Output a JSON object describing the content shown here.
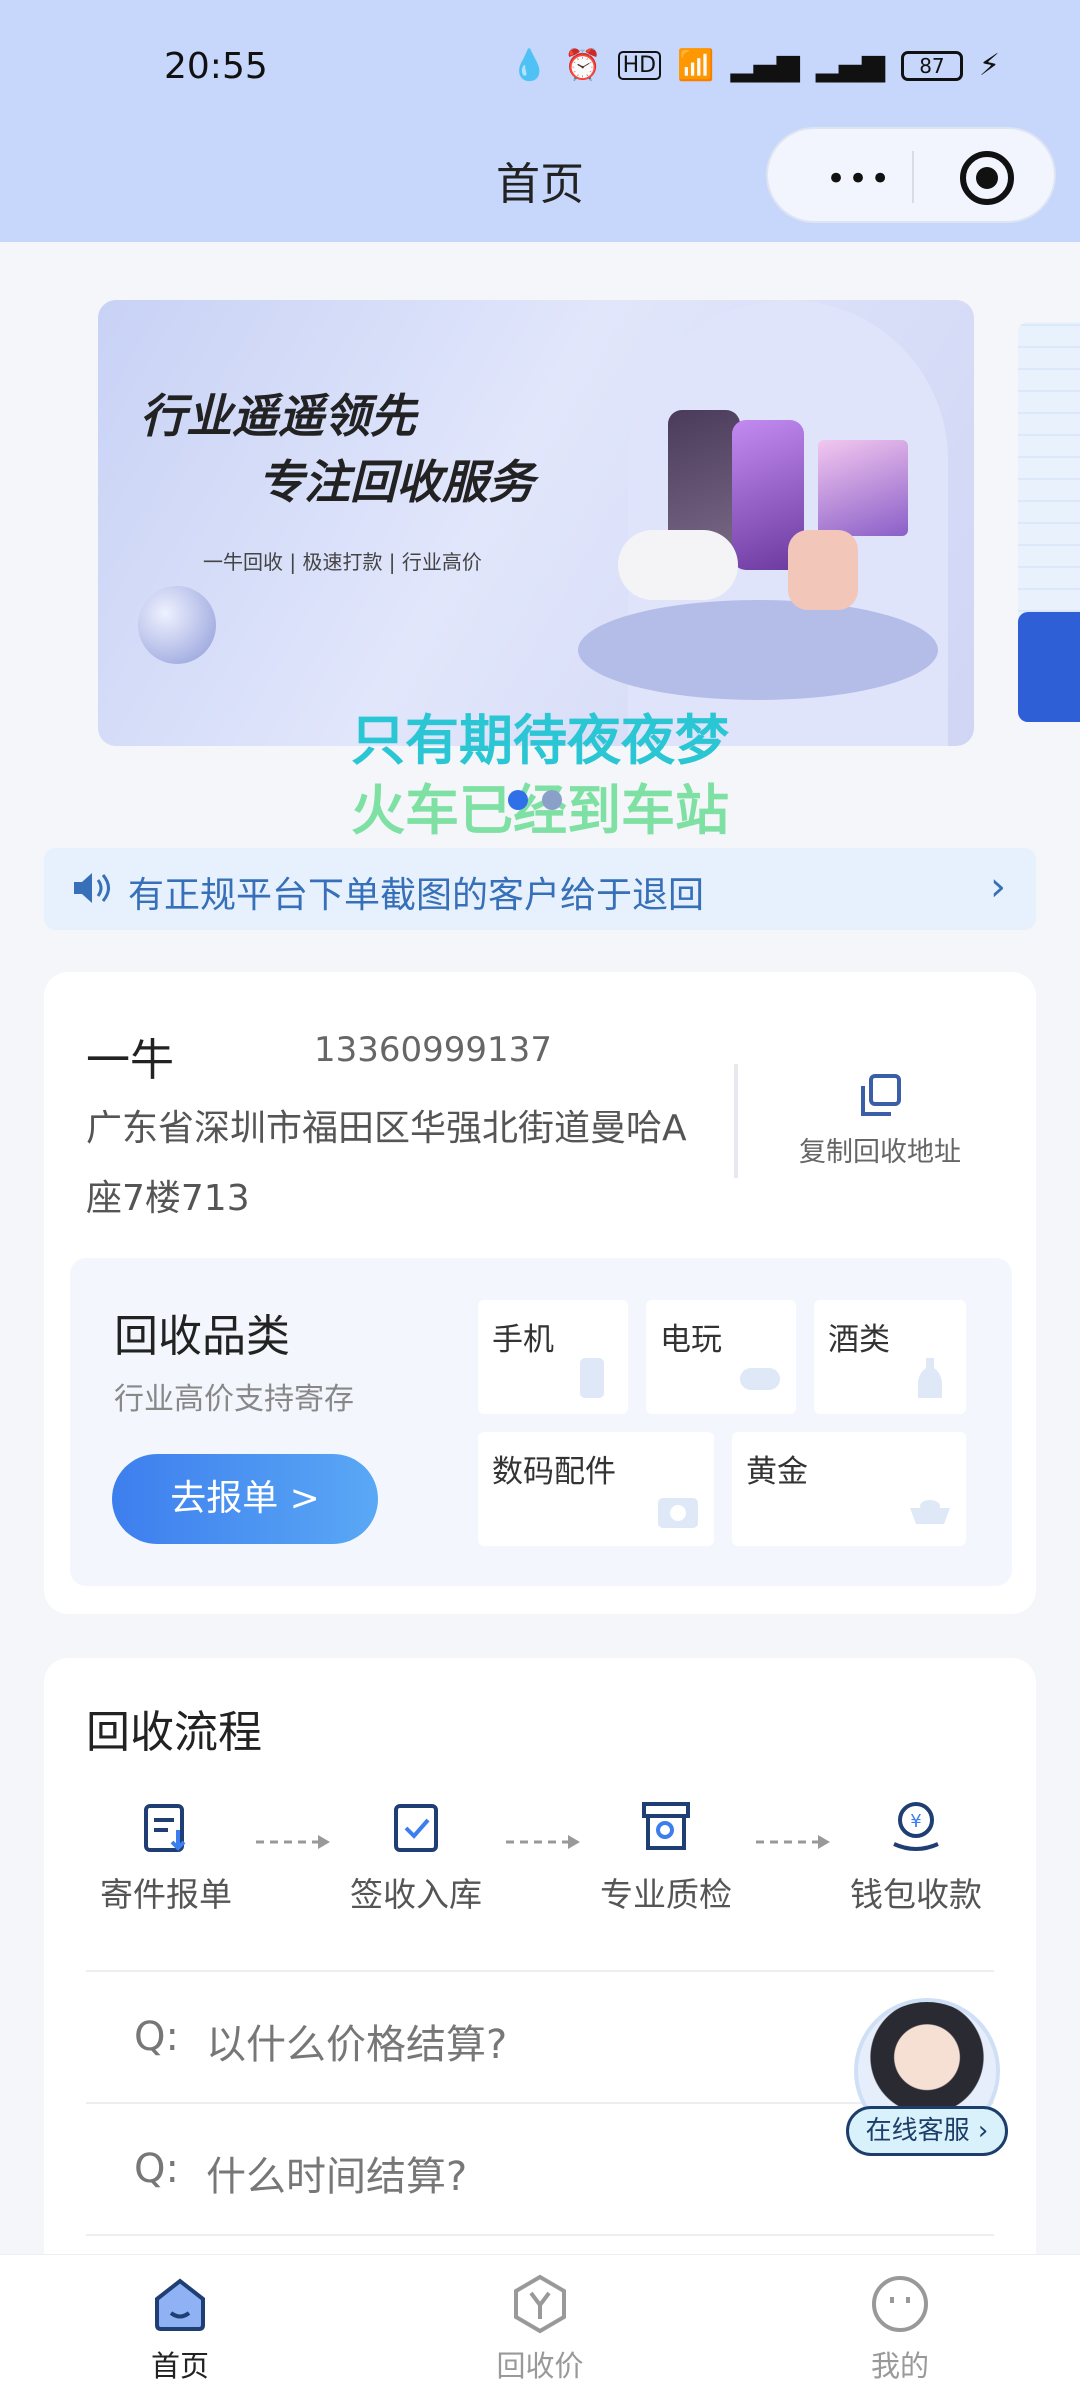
{
  "status_bar": {
    "time": "20:55",
    "battery": "87",
    "network_label": "HD"
  },
  "header": {
    "title": "首页",
    "more_label": "•••"
  },
  "banner": {
    "headline_1": "行业遥遥领先",
    "headline_2": "专注回收服务",
    "subline": "一牛回收 | 极速打款 | 行业高价"
  },
  "danmu": [
    "只有期待夜夜梦",
    "火车已经到车站"
  ],
  "notice": {
    "text": "有正规平台下单截图的客户给于退回"
  },
  "contact": {
    "name": "一牛",
    "phone": "13360999137",
    "address": "广东省深圳市福田区华强北街道曼哈A座7楼713",
    "copy_label": "复制回收地址"
  },
  "categories": {
    "title": "回收品类",
    "subtitle": "行业高价支持寄存",
    "button": "去报单 >",
    "items": [
      {
        "label": "手机",
        "icon": "phone-icon"
      },
      {
        "label": "电玩",
        "icon": "gamepad-icon"
      },
      {
        "label": "酒类",
        "icon": "bottle-icon"
      },
      {
        "label": "数码配件",
        "icon": "camera-icon"
      },
      {
        "label": "黄金",
        "icon": "gold-ingot-icon"
      }
    ]
  },
  "flow": {
    "title": "回收流程",
    "steps": [
      {
        "label": "寄件报单",
        "icon": "clipboard-icon"
      },
      {
        "label": "签收入库",
        "icon": "check-clipboard-icon"
      },
      {
        "label": "专业质检",
        "icon": "inspect-box-icon"
      },
      {
        "label": "钱包收款",
        "icon": "money-hand-icon"
      }
    ],
    "faq": [
      {
        "q": "Q:",
        "text": "以什么价格结算?"
      },
      {
        "q": "Q:",
        "text": "什么时间结算?"
      }
    ]
  },
  "agent": {
    "label": "在线客服 ›"
  },
  "tabbar": [
    {
      "label": "首页",
      "icon": "home-icon",
      "active": true
    },
    {
      "label": "回收价",
      "icon": "yen-price-icon",
      "active": false
    },
    {
      "label": "我的",
      "icon": "profile-face-icon",
      "active": false
    }
  ],
  "colors": {
    "accent": "#3d7eee",
    "header_bg": "#c7d6fb",
    "notice_text": "#3770b8"
  }
}
